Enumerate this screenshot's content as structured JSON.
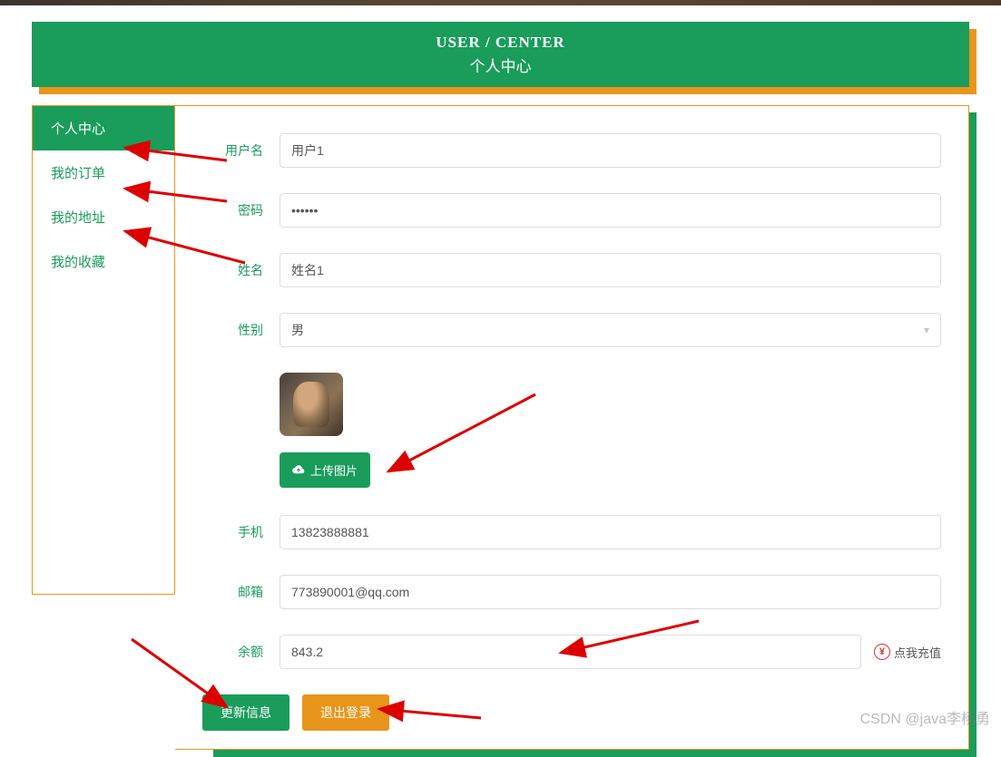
{
  "header": {
    "title_en": "USER / CENTER",
    "title_cn": "个人中心"
  },
  "sidebar": {
    "items": [
      {
        "label": "个人中心",
        "active": true
      },
      {
        "label": "我的订单",
        "active": false
      },
      {
        "label": "我的地址",
        "active": false
      },
      {
        "label": "我的收藏",
        "active": false
      }
    ]
  },
  "form": {
    "username": {
      "label": "用户名",
      "value": "用户1"
    },
    "password": {
      "label": "密码",
      "value": "••••••"
    },
    "name": {
      "label": "姓名",
      "value": "姓名1"
    },
    "gender": {
      "label": "性别",
      "value": "男"
    },
    "upload": {
      "label": "上传图片"
    },
    "phone": {
      "label": "手机",
      "value": "13823888881"
    },
    "email": {
      "label": "邮箱",
      "value": "773890001@qq.com"
    },
    "balance": {
      "label": "余额",
      "value": "843.2",
      "recharge": "点我充值",
      "yen": "¥"
    }
  },
  "buttons": {
    "update": "更新信息",
    "logout": "退出登录"
  },
  "watermark": "CSDN @java李杨勇"
}
